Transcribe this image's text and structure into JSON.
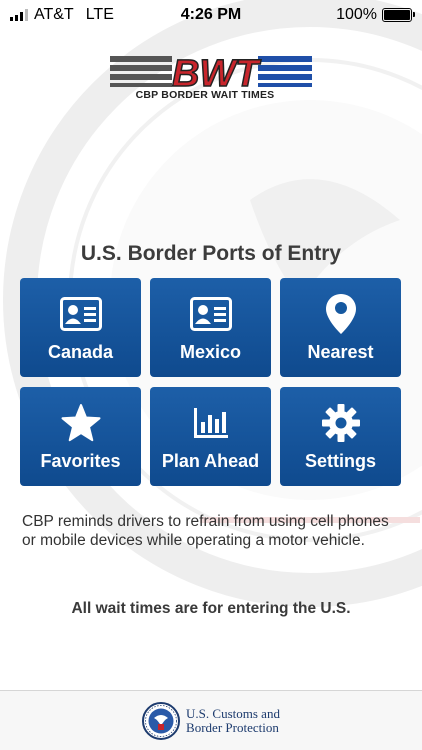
{
  "status_bar": {
    "carrier": "AT&T",
    "network": "LTE",
    "time": "4:26 PM",
    "battery": "100%"
  },
  "logo": {
    "mark": "BWT",
    "subtitle": "CBP BORDER WAIT TIMES"
  },
  "heading": "U.S. Border Ports of Entry",
  "tiles": [
    {
      "label": "Canada",
      "icon": "id-card-icon"
    },
    {
      "label": "Mexico",
      "icon": "id-card-icon"
    },
    {
      "label": "Nearest",
      "icon": "location-pin-icon"
    },
    {
      "label": "Favorites",
      "icon": "star-icon"
    },
    {
      "label": "Plan Ahead",
      "icon": "bar-chart-icon"
    },
    {
      "label": "Settings",
      "icon": "gear-icon"
    }
  ],
  "notice": "CBP reminds drivers to refrain from using cell phones or mobile devices while operating a motor vehicle.",
  "footer_note": "All wait times are for entering the U.S.",
  "footer": {
    "agency_line1": "U.S. Customs and",
    "agency_line2": "Border Protection"
  },
  "colors": {
    "tile_blue": "#1558a0",
    "logo_red": "#c8252c",
    "logo_blue": "#1f4fa8"
  }
}
